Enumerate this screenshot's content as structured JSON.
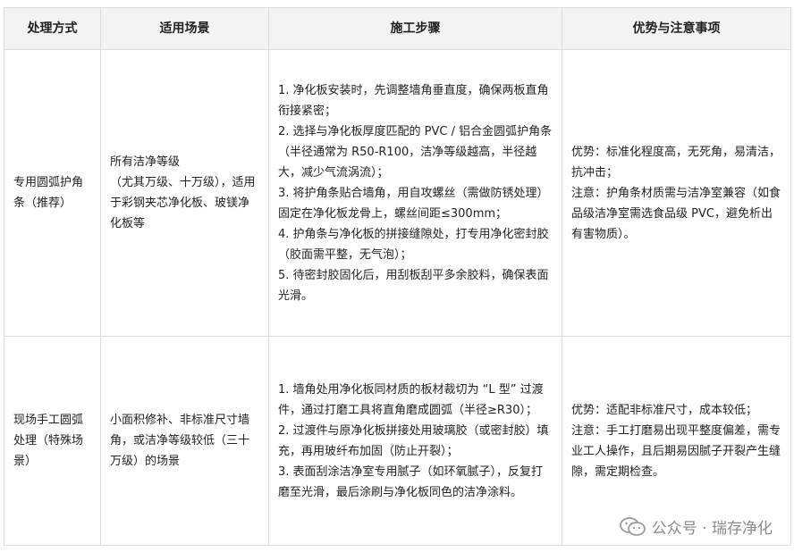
{
  "table": {
    "headers": [
      "处理方式",
      "适用场景",
      "施工步骤",
      "优势与注意事项"
    ],
    "rows": [
      {
        "method": "专用圆弧护角条（推荐）",
        "scene": [
          "所有洁净等级",
          "（尤其万级、十万级），适用于彩钢夹芯净化板、玻镁净化板等"
        ],
        "steps": [
          "1. 净化板安装时，先调整墙角垂直度，确保两板直角衔接紧密；",
          "2. 选择与净化板厚度匹配的 PVC / 铝合金圆弧护角条（半径通常为 R50-R100，洁净等级越高，半径越大，减少气流涡流）；",
          "3. 将护角条贴合墙角，用自攻螺丝（需做防锈处理）固定在净化板龙骨上，螺丝间距≤300mm；",
          "4. 护角条与净化板的拼接缝隙处，打专用净化密封胶（胶面需平整，无气泡）；",
          "5. 待密封胶固化后，用刮板刮平多余胶料，确保表面光滑。"
        ],
        "advantages": [
          "优势：标准化程度高，无死角，易清洁，抗冲击；",
          "注意：护角条材质需与洁净室兼容（如食品级洁净室需选食品级 PVC，避免析出有害物质）。"
        ]
      },
      {
        "method": "现场手工圆弧处理（特殊场景）",
        "scene": [
          "小面积修补、非标准尺寸墙角，或洁净等级较低（三十万级）的场景"
        ],
        "steps": [
          "1. 墙角处用净化板同材质的板材裁切为 “L 型” 过渡件，通过打磨工具将直角磨成圆弧（半径≥R30）；",
          "2. 过渡件与原净化板拼接处用玻璃胶（或密封胶）填充，再用玻纤布加固（防止开裂）；",
          "3. 表面刮涂洁净室专用腻子（如环氧腻子），反复打磨至光滑，最后涂刷与净化板同色的洁净涂料。"
        ],
        "advantages": [
          "优势：适配非标准尺寸，成本较低；",
          "注意：手工打磨易出现平整度偏差，需专业工人操作，且后期易因腻子开裂产生缝隙，需定期检查。"
        ]
      }
    ]
  },
  "watermark": {
    "icon": "wechat-icon",
    "text": "公众号 · 瑞存净化"
  }
}
